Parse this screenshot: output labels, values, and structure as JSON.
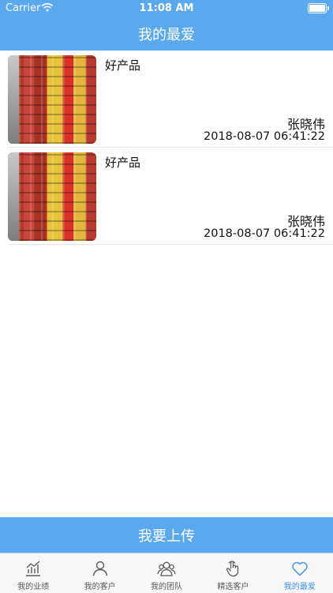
{
  "status_bar": {
    "carrier": "Carrier",
    "time": "11:08 AM"
  },
  "header": {
    "title": "我的最爱"
  },
  "favorites": [
    {
      "title": "好产品",
      "author": "张晓伟",
      "date": "2018-08-07 06:41:22"
    },
    {
      "title": "好产品",
      "author": "张晓伟",
      "date": "2018-08-07 06:41:22"
    }
  ],
  "upload_button": {
    "label": "我要上传"
  },
  "tabs": [
    {
      "label": "我的业绩",
      "icon": "chart-icon",
      "active": false
    },
    {
      "label": "我的客户",
      "icon": "user-icon",
      "active": false
    },
    {
      "label": "我的团队",
      "icon": "team-icon",
      "active": false
    },
    {
      "label": "精选客户",
      "icon": "touch-icon",
      "active": false
    },
    {
      "label": "我的最爱",
      "icon": "heart-icon",
      "active": true
    }
  ],
  "colors": {
    "accent": "#5aa9ee",
    "active_tab": "#3e91e9"
  }
}
